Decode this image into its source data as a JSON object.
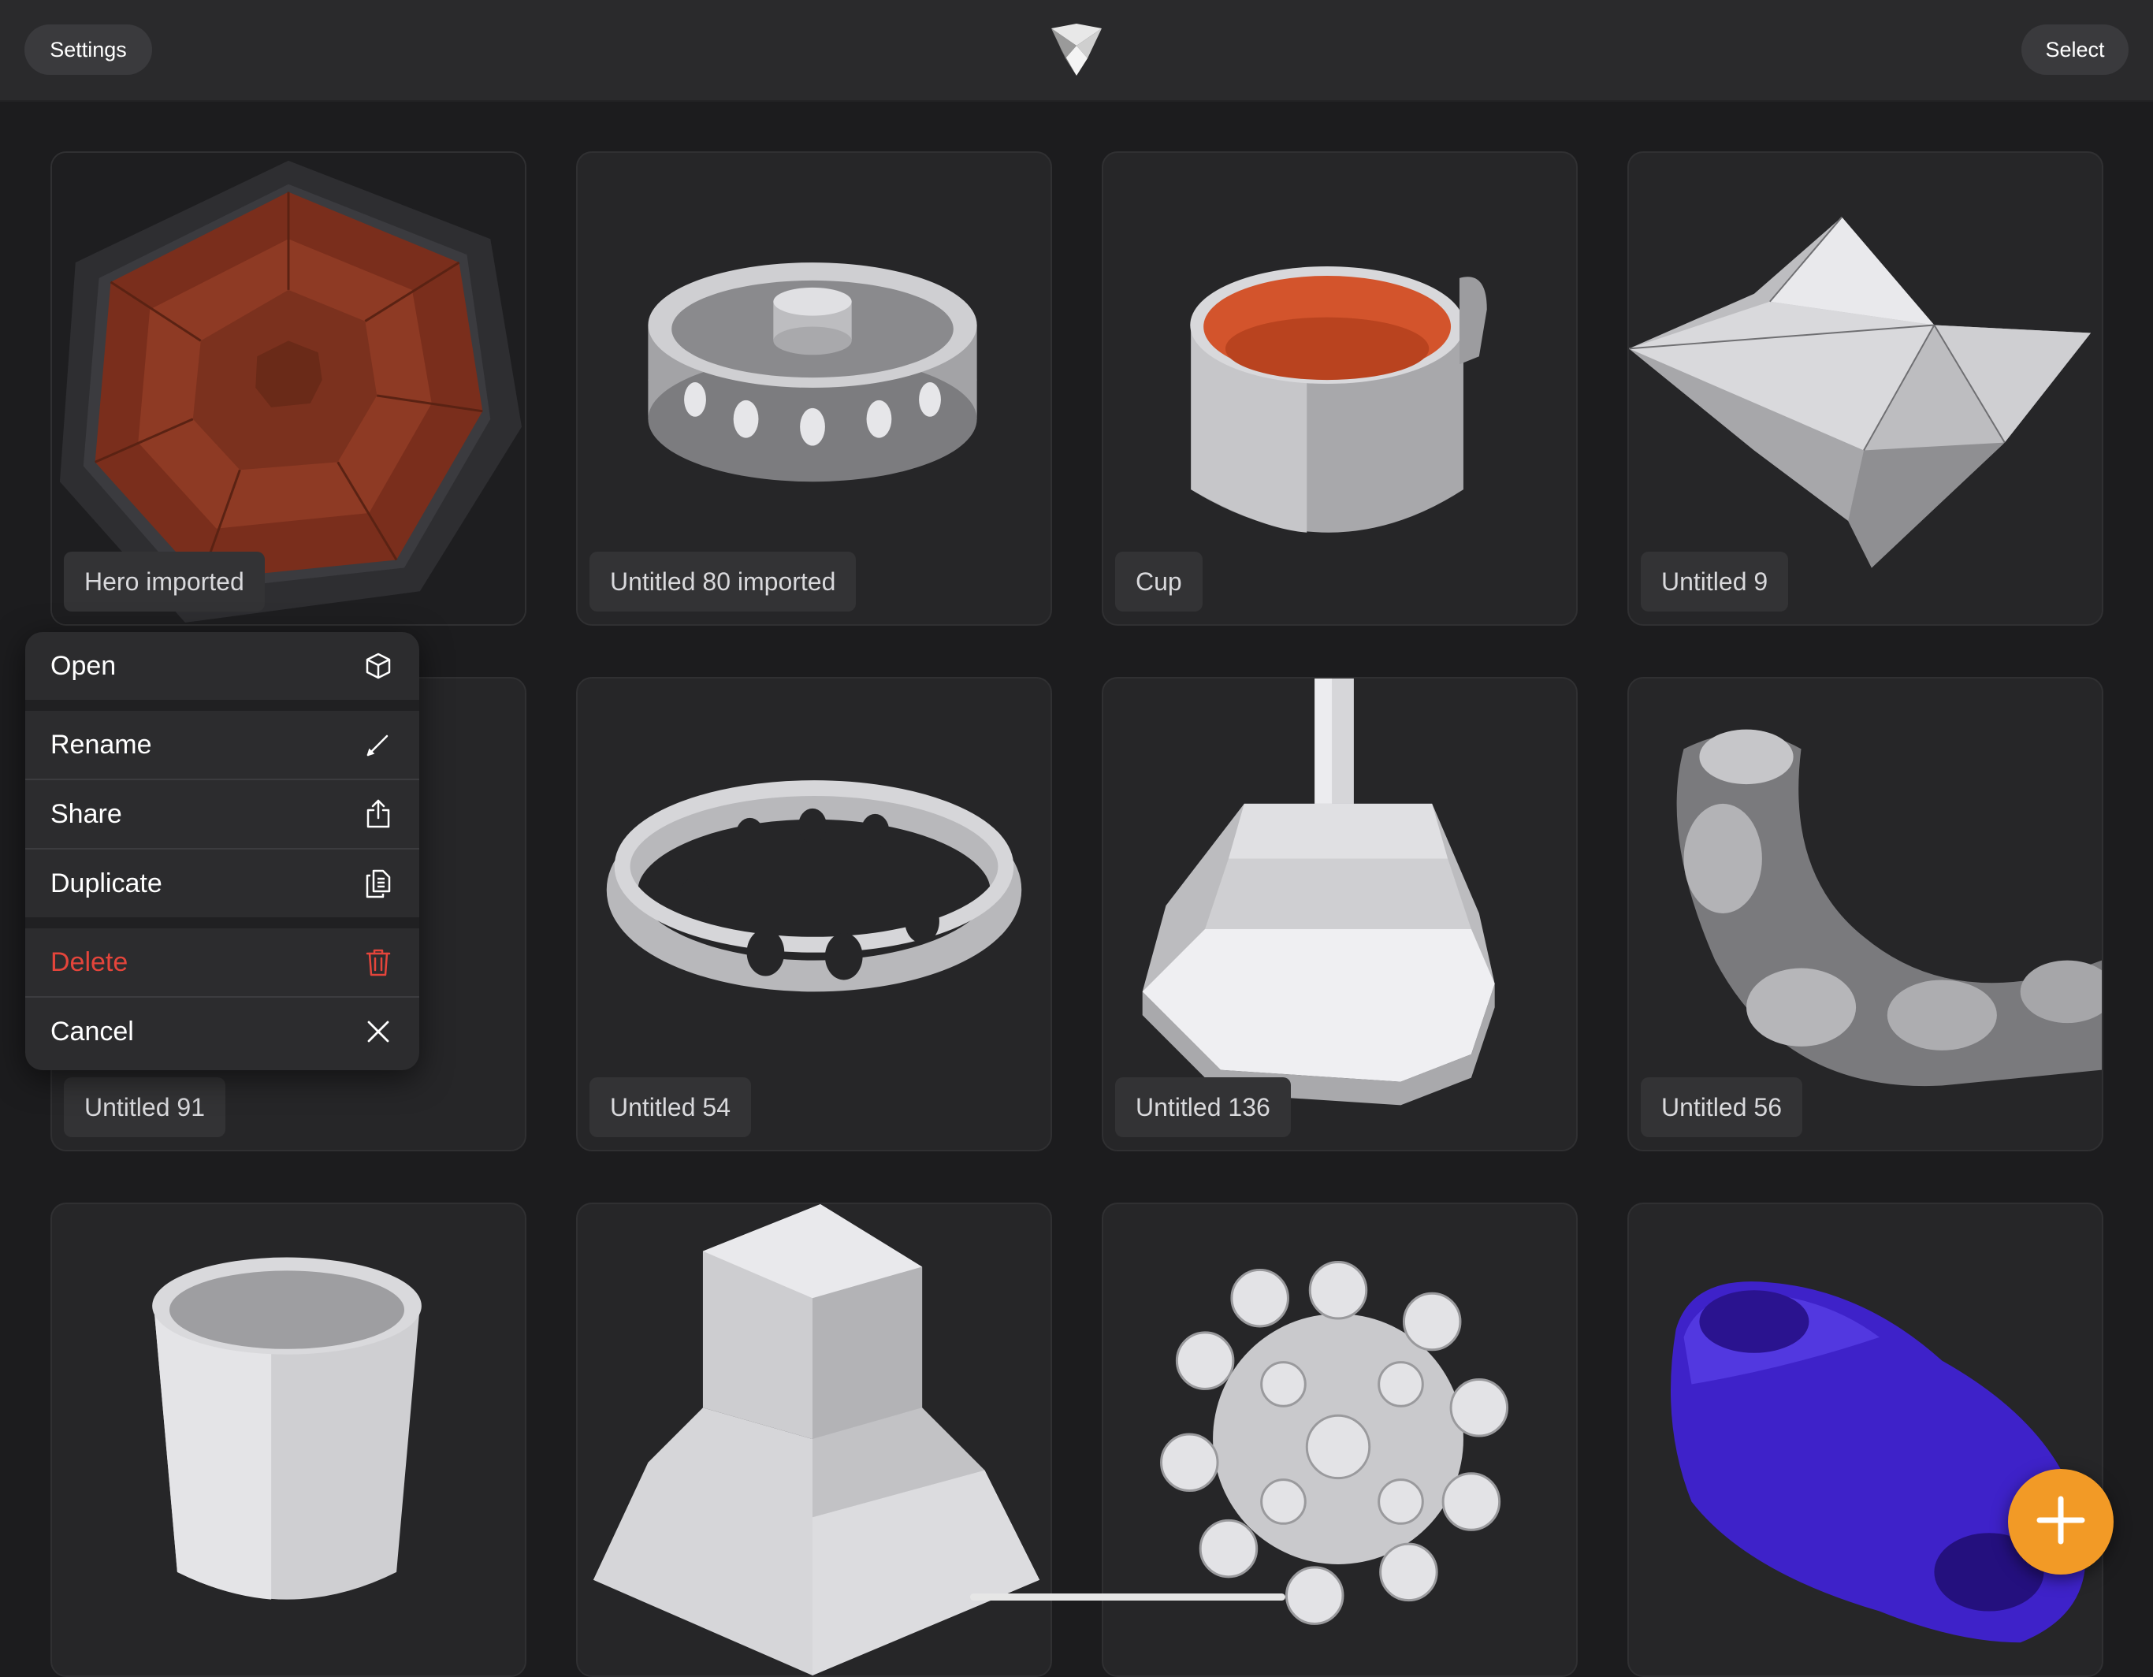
{
  "header": {
    "settings_label": "Settings",
    "select_label": "Select",
    "logo_icon": "app-logo-icon"
  },
  "projects": [
    {
      "name": "Hero imported",
      "thumbnail": "octagon-relief"
    },
    {
      "name": "Untitled 80 imported",
      "thumbnail": "metal-ring-with-lid"
    },
    {
      "name": "Cup",
      "thumbnail": "metal-cup"
    },
    {
      "name": "Untitled 9",
      "thumbnail": "faceted-terrain"
    },
    {
      "name": "Untitled 91",
      "thumbnail": "empty"
    },
    {
      "name": "Untitled 54",
      "thumbnail": "perforated-ring"
    },
    {
      "name": "Untitled 136",
      "thumbnail": "octagonal-base"
    },
    {
      "name": "Untitled 56",
      "thumbnail": "curved-tray"
    },
    {
      "name": "",
      "thumbnail": "white-cup"
    },
    {
      "name": "",
      "thumbnail": "block-base"
    },
    {
      "name": "",
      "thumbnail": "spiked-sphere"
    },
    {
      "name": "",
      "thumbnail": "purple-blob"
    }
  ],
  "context_menu": {
    "items": [
      {
        "label": "Open",
        "icon": "cube-icon"
      },
      {
        "label": "Rename",
        "icon": "pencil-icon"
      },
      {
        "label": "Share",
        "icon": "share-icon"
      },
      {
        "label": "Duplicate",
        "icon": "duplicate-icon"
      },
      {
        "label": "Delete",
        "icon": "trash-icon",
        "color": "#e5453b"
      },
      {
        "label": "Cancel",
        "icon": "close-icon"
      }
    ]
  },
  "fab": {
    "icon": "plus-icon",
    "color": "#f29a26"
  }
}
